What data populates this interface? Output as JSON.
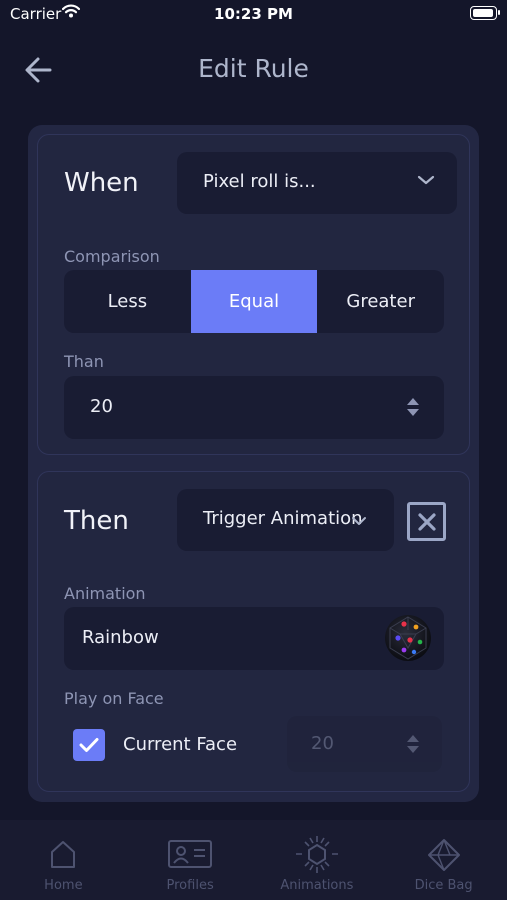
{
  "status_bar": {
    "carrier": "Carrier",
    "time": "10:23 PM"
  },
  "header": {
    "title": "Edit Rule"
  },
  "when": {
    "title": "When",
    "condition": "Pixel roll is...",
    "comparison_label": "Comparison",
    "comparison_options": [
      "Less",
      "Equal",
      "Greater"
    ],
    "comparison_selected": "Equal",
    "than_label": "Than",
    "than_value": "20"
  },
  "then": {
    "title": "Then",
    "action": "Trigger Animation",
    "animation_label": "Animation",
    "animation_value": "Rainbow",
    "play_on_face_label": "Play on Face",
    "current_face_label": "Current Face",
    "current_face_checked": true,
    "face_value": "20"
  },
  "tabs": [
    {
      "label": "Home",
      "icon": "home-icon"
    },
    {
      "label": "Profiles",
      "icon": "profile-card-icon"
    },
    {
      "label": "Animations",
      "icon": "animations-icon"
    },
    {
      "label": "Dice Bag",
      "icon": "dice-bag-icon"
    }
  ],
  "colors": {
    "background": "#14162a",
    "card": "#232743",
    "field": "#191c33",
    "accent": "#6b7cf7",
    "muted_text": "#8e95b4",
    "title_text": "#aeb6cc"
  }
}
